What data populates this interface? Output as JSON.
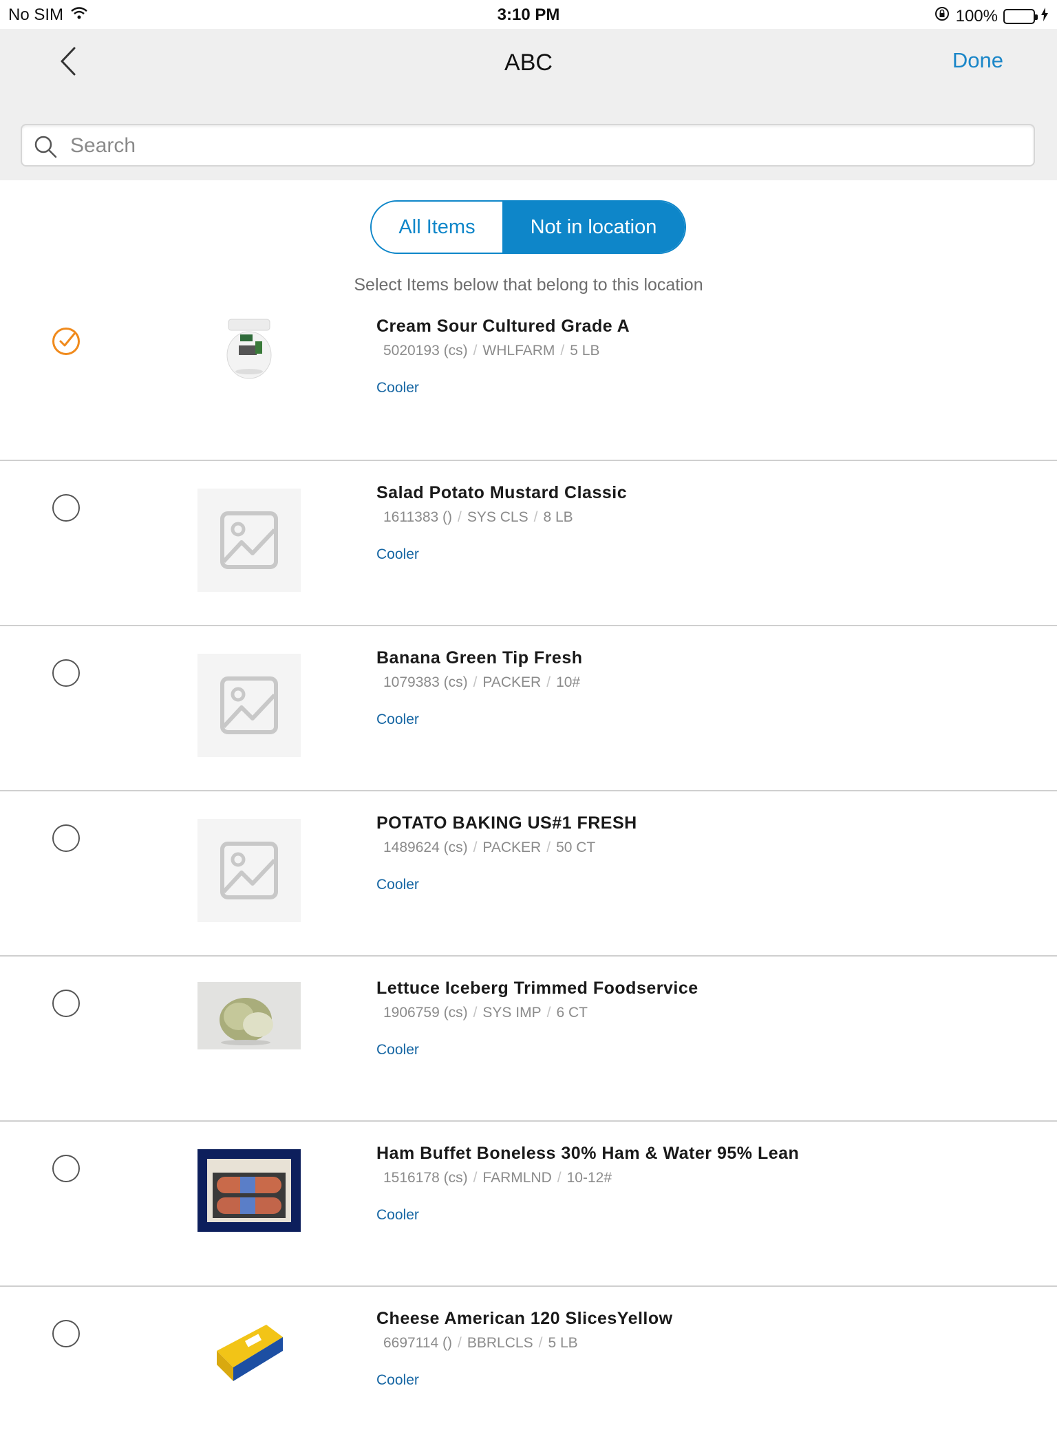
{
  "status": {
    "carrier": "No SIM",
    "time": "3:10 PM",
    "battery": "100%",
    "battery_level": 1.0
  },
  "nav": {
    "title": "ABC",
    "done_label": "Done"
  },
  "search": {
    "placeholder": "Search",
    "value": ""
  },
  "segments": {
    "all_label": "All Items",
    "not_label": "Not in location",
    "selected": "Not in location"
  },
  "instruction": "Select Items below that belong to this location",
  "items": [
    {
      "name": "Cream Sour Cultured Grade A",
      "code": "5020193 (cs)",
      "brand": "WHLFARM",
      "pack": "5 LB",
      "location": "Cooler",
      "checked": true,
      "image": "sour-cream-tub"
    },
    {
      "name": "Salad Potato Mustard Classic",
      "code": "1611383 ()",
      "brand": "SYS CLS",
      "pack": "8 LB",
      "location": "Cooler",
      "checked": false,
      "image": "placeholder"
    },
    {
      "name": "Banana Green Tip Fresh",
      "code": "1079383 (cs)",
      "brand": "PACKER",
      "pack": "10#",
      "location": "Cooler",
      "checked": false,
      "image": "placeholder"
    },
    {
      "name": "POTATO BAKING US#1 FRESH",
      "code": "1489624 (cs)",
      "brand": "PACKER",
      "pack": "50 CT",
      "location": "Cooler",
      "checked": false,
      "image": "placeholder"
    },
    {
      "name": "Lettuce Iceberg Trimmed Foodservice",
      "code": "1906759 (cs)",
      "brand": "SYS IMP",
      "pack": "6 CT",
      "location": "Cooler",
      "checked": false,
      "image": "lettuce-head"
    },
    {
      "name": "Ham Buffet Boneless 30% Ham & Water 95% Lean",
      "code": "1516178 (cs)",
      "brand": "FARMLND",
      "pack": "10-12#",
      "location": "Cooler",
      "checked": false,
      "image": "ham-box"
    },
    {
      "name": "Cheese American 120 SlicesYellow",
      "code": "6697114 ()",
      "brand": "BBRLCLS",
      "pack": "5 LB",
      "location": "Cooler",
      "checked": false,
      "image": "cheese-block"
    }
  ],
  "colors": {
    "accent": "#0e86c9",
    "check_selected": "#f08a1c",
    "location_link": "#1666a3"
  }
}
